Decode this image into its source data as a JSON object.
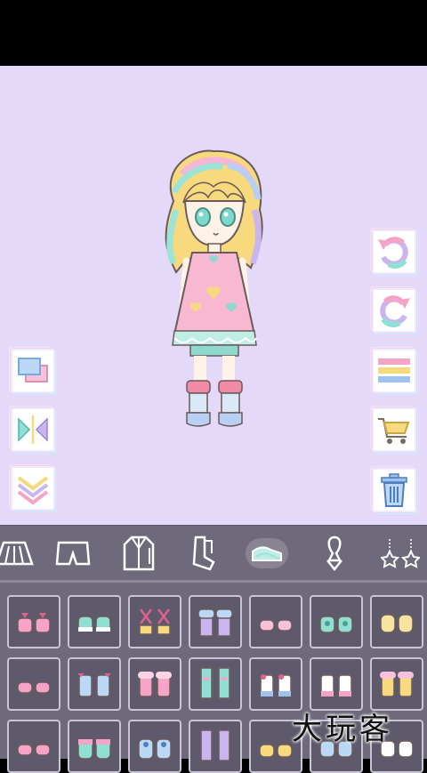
{
  "screen": {
    "name": "dress-up-editor"
  },
  "left_tools": [
    {
      "name": "layer-swap-button",
      "icon": "layers-icon"
    },
    {
      "name": "mirror-flip-button",
      "icon": "flip-horizontal-icon"
    },
    {
      "name": "move-down-button",
      "icon": "chevron-down-double-icon"
    }
  ],
  "right_tools": [
    {
      "name": "undo-button",
      "icon": "undo-rainbow-icon"
    },
    {
      "name": "redo-button",
      "icon": "redo-rainbow-icon"
    },
    {
      "name": "menu-button",
      "icon": "menu-stripes-icon"
    },
    {
      "name": "shop-button",
      "icon": "shopping-cart-icon"
    },
    {
      "name": "delete-button",
      "icon": "trash-icon"
    }
  ],
  "categories": [
    {
      "name": "category-skirt",
      "icon": "skirt-icon"
    },
    {
      "name": "category-shorts",
      "icon": "shorts-icon"
    },
    {
      "name": "category-coat",
      "icon": "coat-icon"
    },
    {
      "name": "category-socks",
      "icon": "socks-icon"
    },
    {
      "name": "category-shoes",
      "icon": "shoes-icon",
      "active": true
    },
    {
      "name": "category-accessory",
      "icon": "accessory-icon"
    },
    {
      "name": "category-charms",
      "icon": "earrings-icon"
    }
  ],
  "item_grid": {
    "rows": 3,
    "cols": 7,
    "items": [
      {
        "icon": "pink-bow-shoes-icon"
      },
      {
        "icon": "mint-shoes-icon"
      },
      {
        "icon": "strappy-sandals-icon"
      },
      {
        "icon": "furry-boots-icon"
      },
      {
        "icon": "pink-flats-icon"
      },
      {
        "icon": "teal-heart-shoes-icon"
      },
      {
        "icon": "yellow-shoes-icon"
      },
      {
        "icon": "pink-flats-icon"
      },
      {
        "icon": "blue-bow-boots-icon"
      },
      {
        "icon": "pink-fluffy-boots-icon"
      },
      {
        "icon": "mint-tall-boots-icon"
      },
      {
        "icon": "white-bow-boots-icon"
      },
      {
        "icon": "white-pink-boots-icon"
      },
      {
        "icon": "yellow-fluffy-boots-icon"
      },
      {
        "icon": "pink-flats-icon"
      },
      {
        "icon": "teal-sneakers-icon"
      },
      {
        "icon": "blue-sneakers-icon"
      },
      {
        "icon": "lavender-long-boots-icon"
      },
      {
        "icon": "yellow-flats-icon"
      },
      {
        "icon": "blue-shoes-icon"
      },
      {
        "icon": "white-shoes-icon"
      }
    ]
  },
  "watermark": {
    "text": "大玩客"
  },
  "colors": {
    "stage": "#e4d9f8",
    "bar": "#6f6a7b",
    "slot_border": "#c9c4d3"
  }
}
